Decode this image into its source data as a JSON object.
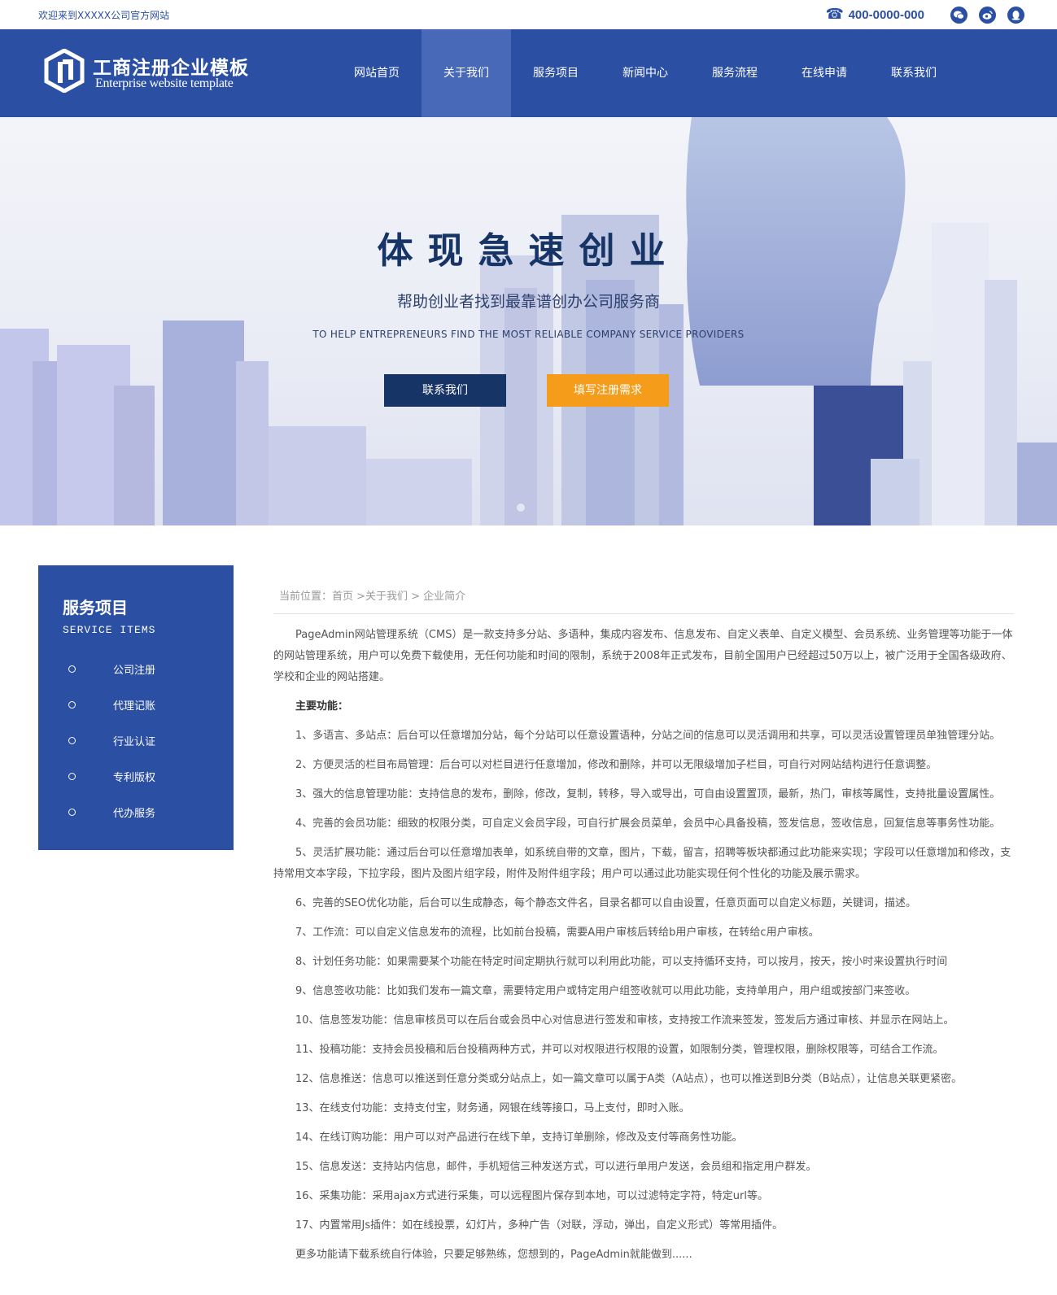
{
  "topbar": {
    "welcome": "欢迎来到XXXXX公司官方网站",
    "phone": "400-0000-000",
    "icons": [
      "phone-icon",
      "wechat-icon",
      "weibo-icon",
      "qq-icon"
    ]
  },
  "header": {
    "brand_cn": "工商注册企业模板",
    "brand_en": "Enterprise website template",
    "nav": [
      "网站首页",
      "关于我们",
      "服务项目",
      "新闻中心",
      "服务流程",
      "在线申请",
      "联系我们"
    ],
    "active_index": 1
  },
  "banner": {
    "title": "体现急速创业",
    "subtitle": "帮助创业者找到最靠谱创办公司服务商",
    "subtitle_en": "TO HELP ENTREPRENEURS FIND THE MOST RELIABLE COMPANY SERVICE PROVIDERS",
    "btn_contact": "联系我们",
    "btn_register": "填写注册需求"
  },
  "sidebar": {
    "title": "服务项目",
    "title_en": "SERVICE ITEMS",
    "items": [
      "公司注册",
      "代理记账",
      "行业认证",
      "专利版权",
      "代办服务"
    ]
  },
  "breadcrumb": "当前位置：首页 >关于我们 > 企业简介",
  "article": {
    "intro": "PageAdmin网站管理系统（CMS）是一款支持多分站、多语种，集成内容发布、信息发布、自定义表单、自定义模型、会员系统、业务管理等功能于一体的网站管理系统，用户可以免费下载使用，无任何功能和时间的限制，系统于2008年正式发布，目前全国用户已经超过50万以上，被广泛用于全国各级政府、学校和企业的网站搭建。",
    "heading": "主要功能：",
    "items": [
      "1、多语言、多站点：后台可以任意增加分站，每个分站可以任意设置语种，分站之间的信息可以灵活调用和共享，可以灵活设置管理员单独管理分站。",
      "2、方便灵活的栏目布局管理：后台可以对栏目进行任意增加，修改和删除，并可以无限级增加子栏目，可自行对网站结构进行任意调整。",
      "3、强大的信息管理功能：支持信息的发布，删除，修改，复制，转移，导入或导出，可自由设置置顶，最新，热门，审核等属性，支持批量设置属性。",
      "4、完善的会员功能：细致的权限分类，可自定义会员字段，可自行扩展会员菜单，会员中心具备投稿，签发信息，签收信息，回复信息等事务性功能。",
      "5、灵活扩展功能：通过后台可以任意增加表单，如系统自带的文章，图片，下载，留言，招聘等板块都通过此功能来实现；字段可以任意增加和修改，支持常用文本字段，下拉字段，图片及图片组字段，附件及附件组字段；用户可以通过此功能实现任何个性化的功能及展示需求。",
      "6、完善的SEO优化功能，后台可以生成静态，每个静态文件名，目录名都可以自由设置，任意页面可以自定义标题，关键词，描述。",
      "7、工作流：可以自定义信息发布的流程，比如前台投稿，需要A用户审核后转给b用户审核，在转给c用户审核。",
      "8、计划任务功能：如果需要某个功能在特定时间定期执行就可以利用此功能，可以支持循环支持，可以按月，按天，按小时来设置执行时间",
      "9、信息签收功能：比如我们发布一篇文章，需要特定用户或特定用户组签收就可以用此功能，支持单用户，用户组或按部门来签收。",
      "10、信息签发功能：信息审核员可以在后台或会员中心对信息进行签发和审核，支持按工作流来签发，签发后方通过审核、并显示在网站上。",
      "11、投稿功能：支持会员投稿和后台投稿两种方式，并可以对权限进行权限的设置，如限制分类，管理权限，删除权限等，可结合工作流。",
      "12、信息推送：信息可以推送到任意分类或分站点上，如一篇文章可以属于A类（A站点），也可以推送到B分类（B站点），让信息关联更紧密。",
      "13、在线支付功能：支持支付宝，财务通，网银在线等接口，马上支付，即时入账。",
      "14、在线订购功能：用户可以对产品进行在线下单，支持订单删除，修改及支付等商务性功能。",
      "15、信息发送：支持站内信息，邮件，手机短信三种发送方式，可以进行单用户发送，会员组和指定用户群发。",
      "16、采集功能：采用ajax方式进行采集，可以远程图片保存到本地，可以过滤特定字符，特定url等。",
      "17、内置常用Js插件：如在线投票，幻灯片，多种广告（对联，浮动，弹出，自定义形式）等常用插件。"
    ],
    "footer": "更多功能请下载系统自行体验，只要足够熟练，您想到的，PageAdmin就能做到......"
  }
}
